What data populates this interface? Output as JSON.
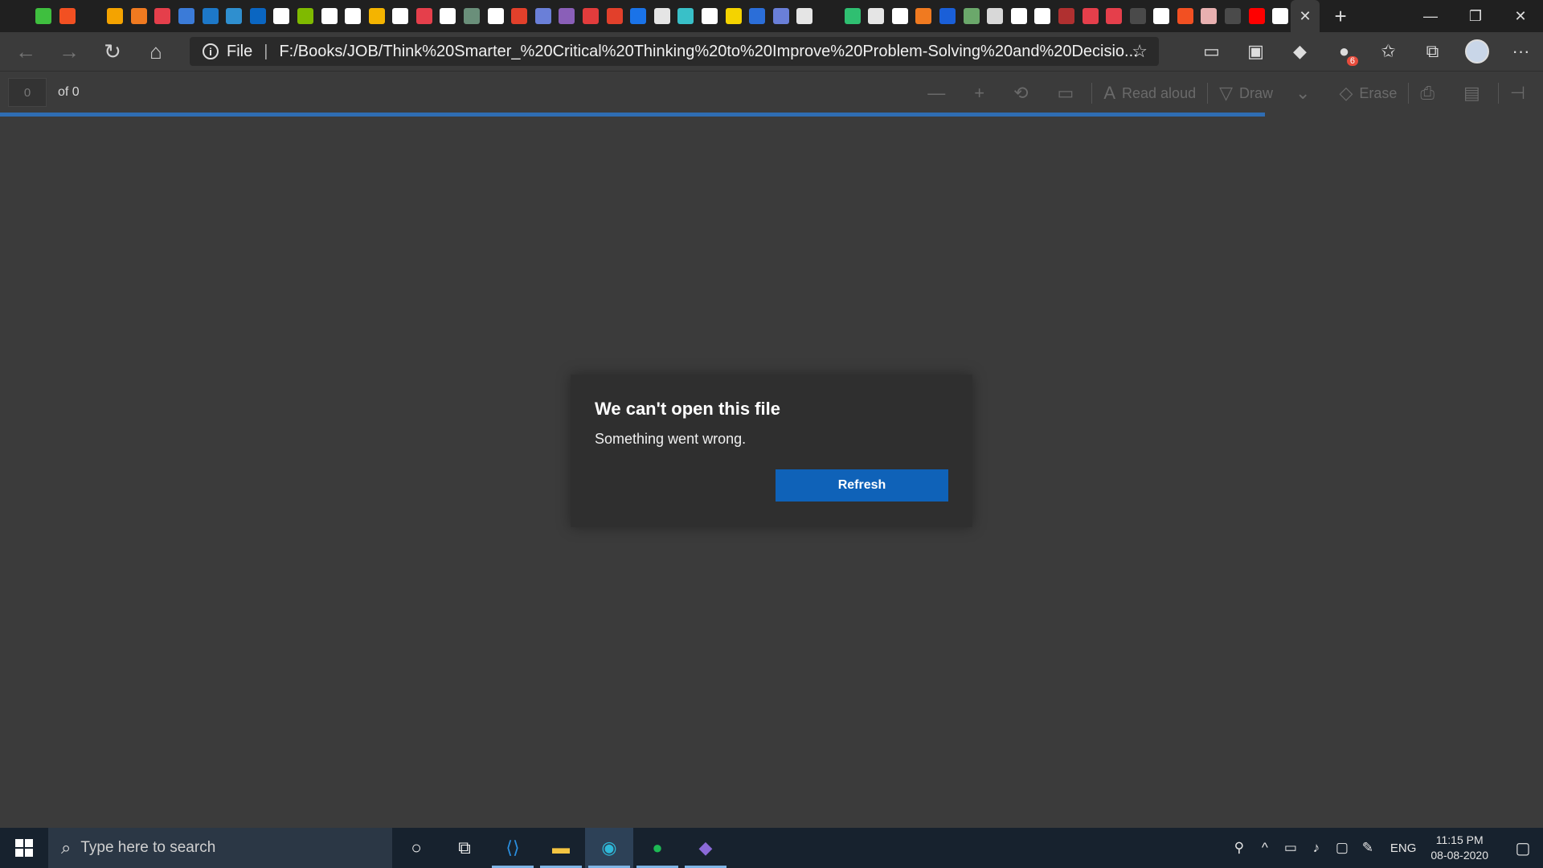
{
  "favicons": [
    {
      "name": "speaker-icon",
      "color": "#202020"
    },
    {
      "name": "dh-icon",
      "color": "#3fbf3f"
    },
    {
      "name": "microsoft-icon",
      "color": "#f25022"
    },
    {
      "name": "angular-a-icon",
      "color": "#202020"
    },
    {
      "name": "bars-chart-icon",
      "color": "#f4a300"
    },
    {
      "name": "hexagon-icon",
      "color": "#f07a20"
    },
    {
      "name": "pocket-icon",
      "color": "#e53f4b"
    },
    {
      "name": "java-icon",
      "color": "#3b7bd8"
    },
    {
      "name": "sap-icon",
      "color": "#1d78c8"
    },
    {
      "name": "check-icon",
      "color": "#2f8fcf"
    },
    {
      "name": "linkedin-icon",
      "color": "#0a66c2"
    },
    {
      "name": "google-icon",
      "color": "#ffffff"
    },
    {
      "name": "microsoft-icon",
      "color": "#7fba00"
    },
    {
      "name": "code-icon",
      "color": "#ffffff"
    },
    {
      "name": "google-icon",
      "color": "#ffffff"
    },
    {
      "name": "cloud-icon",
      "color": "#f4b400"
    },
    {
      "name": "google-icon",
      "color": "#ffffff"
    },
    {
      "name": "play-icon",
      "color": "#e53f4b"
    },
    {
      "name": "circle-icon",
      "color": "#ffffff"
    },
    {
      "name": "book-icon",
      "color": "#6a8f7a"
    },
    {
      "name": "amazon-icon",
      "color": "#ffffff"
    },
    {
      "name": "mountain-icon",
      "color": "#e2402b"
    },
    {
      "name": "infinity-icon",
      "color": "#6a7fd8"
    },
    {
      "name": "spiral-icon",
      "color": "#8a5fb8"
    },
    {
      "name": "u-icon",
      "color": "#e23c3c"
    },
    {
      "name": "mountain-icon",
      "color": "#e2402b"
    },
    {
      "name": "s-icon",
      "color": "#1a73e8"
    },
    {
      "name": "edx-icon",
      "color": "#e5e5e5"
    },
    {
      "name": "q-icon",
      "color": "#39c0c8"
    },
    {
      "name": "amazon-icon",
      "color": "#ffffff"
    },
    {
      "name": "note-icon",
      "color": "#f4d300"
    },
    {
      "name": "dd-icon",
      "color": "#2b6ed8"
    },
    {
      "name": "infinity-icon",
      "color": "#6a7fd8"
    },
    {
      "name": "edx-icon",
      "color": "#e5e5e5"
    },
    {
      "name": "sk-icon",
      "color": "#202020"
    },
    {
      "name": "shield-icon",
      "color": "#2fbf71"
    },
    {
      "name": "edx-icon",
      "color": "#e5e5e5"
    },
    {
      "name": "ted-icon",
      "color": "#ffffff"
    },
    {
      "name": "b-icon",
      "color": "#f07a20"
    },
    {
      "name": "c-icon",
      "color": "#1a5fd8"
    },
    {
      "name": "link-icon",
      "color": "#6ba86b"
    },
    {
      "name": "mit-icon",
      "color": "#d8d8d8"
    },
    {
      "name": "github-icon",
      "color": "#ffffff"
    },
    {
      "name": "amazon-icon",
      "color": "#ffffff"
    },
    {
      "name": "pd-icon",
      "color": "#b03030"
    },
    {
      "name": "pdf-icon",
      "color": "#e53f4b"
    },
    {
      "name": "pdf-icon",
      "color": "#e53f4b"
    },
    {
      "name": "globe-icon",
      "color": "#4a4a4a"
    },
    {
      "name": "page-icon",
      "color": "#ffffff"
    },
    {
      "name": "microsoft-icon",
      "color": "#f25022"
    },
    {
      "name": "flower-icon",
      "color": "#e8b0b0"
    },
    {
      "name": "globe-icon",
      "color": "#4a4a4a"
    },
    {
      "name": "youtube-icon",
      "color": "#ff0000"
    },
    {
      "name": "google-icon",
      "color": "#ffffff"
    }
  ],
  "tab": {
    "close_glyph": "✕"
  },
  "new_tab_glyph": "+",
  "window": {
    "minimize": "—",
    "restore": "❐",
    "close": "✕"
  },
  "nav": {
    "back": "←",
    "forward": "→",
    "refresh": "↻",
    "home": "⌂"
  },
  "address": {
    "info_glyph": "i",
    "scheme": "File",
    "separator": "|",
    "url": "F:/Books/JOB/Think%20Smarter_%20Critical%20Thinking%20to%20Improve%20Problem-Solving%20and%20Decisio...",
    "star_glyph": "☆"
  },
  "extensions": [
    {
      "name": "cast-icon",
      "glyph": "▭"
    },
    {
      "name": "square-extension-icon",
      "glyph": "▣"
    },
    {
      "name": "diamond-extension-icon",
      "glyph": "◆"
    },
    {
      "name": "grammarly-icon",
      "glyph": "●",
      "badge": "6"
    },
    {
      "name": "favorites-icon",
      "glyph": "✩"
    },
    {
      "name": "collections-icon",
      "glyph": "⧉"
    }
  ],
  "more_glyph": "···",
  "pdf": {
    "page_value": "0",
    "page_of": "of 0",
    "zoom_out": "—",
    "zoom_in": "+",
    "rotate": "⟲",
    "fit": "▭",
    "read_aloud_glyph": "A",
    "read_aloud": "Read aloud",
    "draw_glyph": "▽",
    "draw": "Draw",
    "dropdown_glyph": "⌄",
    "erase_glyph": "◇",
    "erase": "Erase",
    "print_glyph": "⎙",
    "save_glyph": "▤",
    "pin_glyph": "⊣",
    "load_progress": 0.82
  },
  "dialog": {
    "title": "We can't open this file",
    "message": "Something went wrong.",
    "refresh_label": "Refresh"
  },
  "taskbar": {
    "search_placeholder": "Type here to search",
    "search_glyph": "⌕",
    "cortana_glyph": "○",
    "taskview_glyph": "⧉",
    "apps": [
      {
        "name": "vscode-icon",
        "glyph": "⟨⟩",
        "color": "#2a8fe0",
        "active": false
      },
      {
        "name": "file-explorer-icon",
        "glyph": "▬",
        "color": "#f4c542",
        "active": false
      },
      {
        "name": "edge-icon",
        "glyph": "◉",
        "color": "#2fb8d8",
        "active": true
      },
      {
        "name": "spotify-icon",
        "glyph": "●",
        "color": "#1db954",
        "active": false
      },
      {
        "name": "visual-studio-icon",
        "glyph": "◆",
        "color": "#8b6ad8",
        "active": false
      }
    ],
    "tray": {
      "people_glyph": "⚲",
      "chevron_glyph": "^",
      "battery_glyph": "▭",
      "volume_glyph": "♪",
      "network_glyph": "▢",
      "pen_glyph": "✎",
      "language": "ENG",
      "time": "11:15 PM",
      "date": "08-08-2020",
      "notification_glyph": "▢"
    }
  }
}
